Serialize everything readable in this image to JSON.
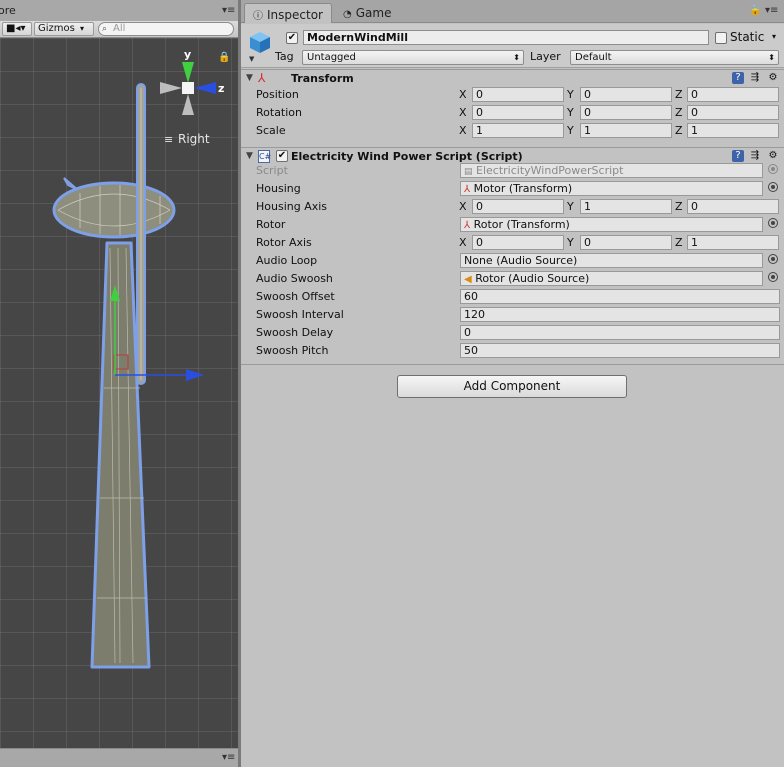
{
  "scene": {
    "tab_partial": "ore",
    "toolbar": {
      "gizmos_label": "Gizmos",
      "search_placeholder": "All"
    },
    "gizmo": {
      "y_label": "y",
      "z_label": "z",
      "view_label": "Right"
    }
  },
  "inspector": {
    "tabs": [
      {
        "label": "Inspector"
      },
      {
        "label": "Game"
      }
    ],
    "object": {
      "active": true,
      "name": "ModernWindMill",
      "static_label": "Static",
      "static": false,
      "tag_label": "Tag",
      "tag_value": "Untagged",
      "layer_label": "Layer",
      "layer_value": "Default"
    },
    "transform": {
      "title": "Transform",
      "rows": [
        {
          "label": "Position",
          "x": "0",
          "y": "0",
          "z": "0"
        },
        {
          "label": "Rotation",
          "x": "0",
          "y": "0",
          "z": "0"
        },
        {
          "label": "Scale",
          "x": "1",
          "y": "1",
          "z": "1"
        }
      ]
    },
    "script_component": {
      "title": "Electricity Wind Power Script (Script)",
      "enabled": true,
      "script_label": "Script",
      "script_value": "ElectricityWindPowerScript",
      "housing_label": "Housing",
      "housing_value": "Motor (Transform)",
      "housing_axis_label": "Housing Axis",
      "housing_axis": {
        "x": "0",
        "y": "1",
        "z": "0"
      },
      "rotor_label": "Rotor",
      "rotor_value": "Rotor (Transform)",
      "rotor_axis_label": "Rotor Axis",
      "rotor_axis": {
        "x": "0",
        "y": "0",
        "z": "1"
      },
      "audio_loop_label": "Audio Loop",
      "audio_loop_value": "None (Audio Source)",
      "audio_swoosh_label": "Audio Swoosh",
      "audio_swoosh_value": "Rotor (Audio Source)",
      "swoosh_offset_label": "Swoosh Offset",
      "swoosh_offset_value": "60",
      "swoosh_interval_label": "Swoosh Interval",
      "swoosh_interval_value": "120",
      "swoosh_delay_label": "Swoosh Delay",
      "swoosh_delay_value": "0",
      "swoosh_pitch_label": "Swoosh Pitch",
      "swoosh_pitch_value": "50"
    },
    "add_component_label": "Add Component",
    "axis_labels": {
      "x": "X",
      "y": "Y",
      "z": "Z"
    }
  },
  "colors": {
    "panel_bg": "#c2c2c2",
    "scene_bg": "#464646",
    "selection_outline": "#6f8fd6",
    "axis_y": "#3fcf3f",
    "axis_z": "#2a4fe0"
  }
}
